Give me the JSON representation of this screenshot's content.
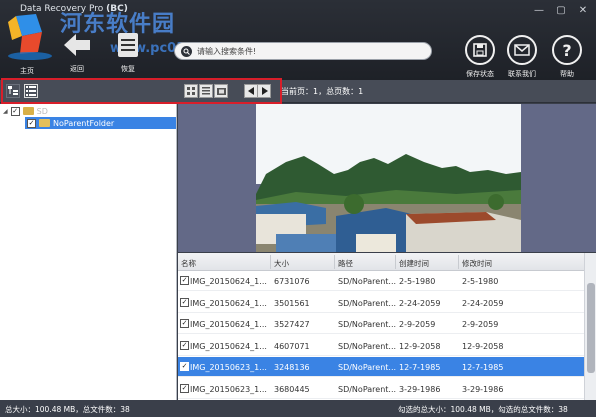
{
  "window": {
    "title": "Data Recovery Pro",
    "title_suffix": "(BC)",
    "watermark": "河东软件园",
    "watermark_url": "www.pc0359.cn",
    "controls": [
      "—",
      "▢",
      "✕"
    ]
  },
  "toolbar": {
    "home_label": "主页",
    "back_label": "返回",
    "recover_label": "恢复",
    "save_state_label": "保存状态",
    "contact_label": "联系我们",
    "help_label": "帮助"
  },
  "search": {
    "placeholder": "请输入搜索条件!"
  },
  "viewbar": {
    "page_info": "当前页：1，总页数：1"
  },
  "tree": {
    "root_label": "SD",
    "child_label": "NoParentFolder"
  },
  "table": {
    "columns": [
      "名称",
      "大小",
      "路径",
      "创建时间",
      "修改时间"
    ],
    "rows": [
      {
        "name": "IMG_20150624_1...",
        "size": "6731076",
        "path": "SD/NoParent...",
        "created": "2-5-1980",
        "modified": "2-5-1980"
      },
      {
        "name": "IMG_20150624_1...",
        "size": "3501561",
        "path": "SD/NoParent...",
        "created": "2-24-2059",
        "modified": "2-24-2059"
      },
      {
        "name": "IMG_20150624_1...",
        "size": "3527427",
        "path": "SD/NoParent...",
        "created": "2-9-2059",
        "modified": "2-9-2059"
      },
      {
        "name": "IMG_20150624_1...",
        "size": "4607071",
        "path": "SD/NoParent...",
        "created": "12-9-2058",
        "modified": "12-9-2058"
      },
      {
        "name": "IMG_20150623_1...",
        "size": "3248136",
        "path": "SD/NoParent...",
        "created": "12-7-1985",
        "modified": "12-7-1985"
      },
      {
        "name": "IMG_20150623_1...",
        "size": "3680445",
        "path": "SD/NoParent...",
        "created": "3-29-1986",
        "modified": "3-29-1986"
      }
    ],
    "selected_row": 4
  },
  "status": {
    "total_left": "总大小：100.48 MB，总文件数：38",
    "total_right": "勾选的总大小：100.48 MB，勾选的总文件数：38"
  },
  "colors": {
    "selection": "#3a83e4",
    "highlight_box": "#d81e2a",
    "toolbar_bg": "#25292f"
  }
}
